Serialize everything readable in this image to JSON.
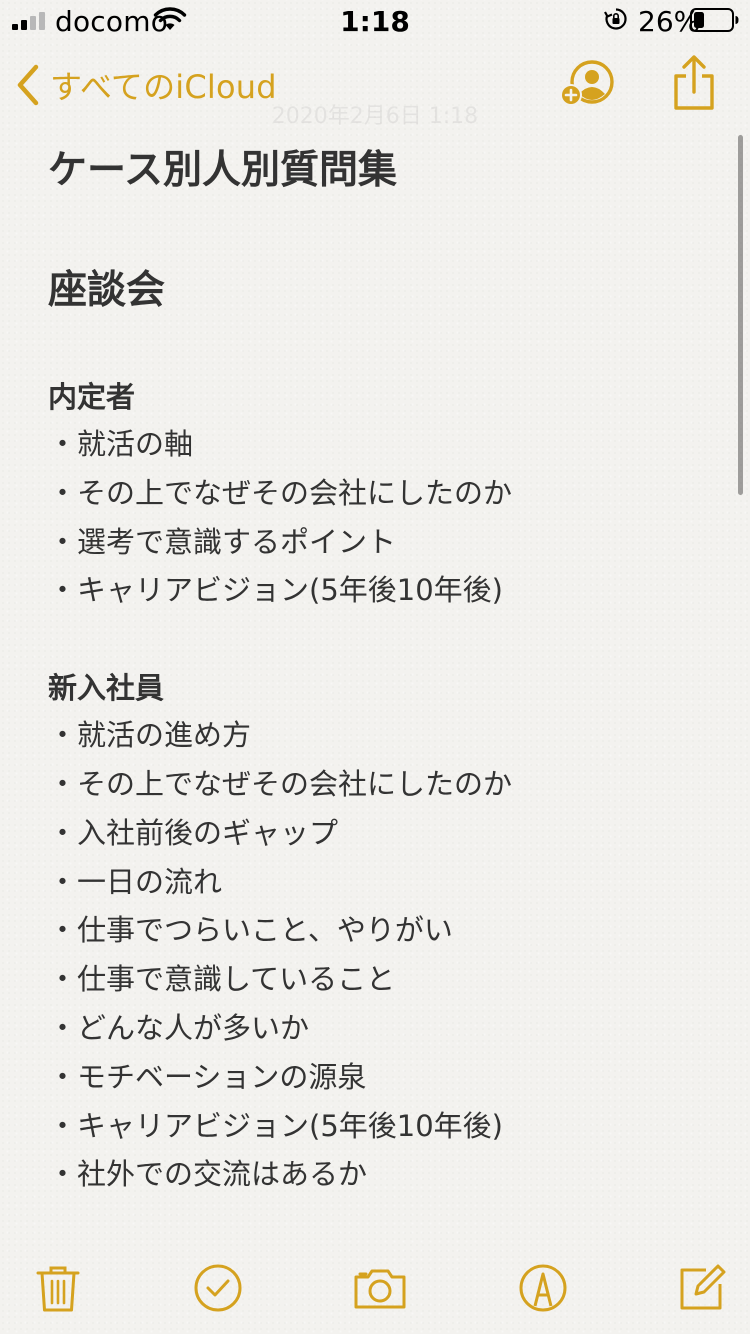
{
  "status_bar": {
    "carrier": "docomo",
    "time": "1:18",
    "battery_percent": "26%",
    "battery_level": 0.26
  },
  "nav": {
    "back_label": "すべてのiCloud",
    "faded_date": "2020年2月6日 1:18"
  },
  "note": {
    "title": "ケース別人別質問集",
    "heading": "座談会",
    "sections": [
      {
        "heading": "内定者",
        "items": [
          "・就活の軸",
          "・その上でなぜその会社にしたのか",
          "・選考で意識するポイント",
          "・キャリアビジョン(5年後10年後)"
        ]
      },
      {
        "heading": "新入社員",
        "items": [
          "・就活の進め方",
          "・その上でなぜその会社にしたのか",
          "・入社前後のギャップ",
          "・一日の流れ",
          "・仕事でつらいこと、やりがい",
          "・仕事で意識していること",
          "・どんな人が多いか",
          "・モチベーションの源泉",
          "・キャリアビジョン(5年後10年後)",
          "・社外での交流はあるか"
        ]
      }
    ]
  },
  "toolbar": {
    "icons": [
      "trash-icon",
      "checklist-icon",
      "camera-icon",
      "markup-icon",
      "compose-icon"
    ]
  },
  "colors": {
    "accent": "#d5a21f",
    "text": "#333333",
    "paper": "#f3f2ef"
  }
}
